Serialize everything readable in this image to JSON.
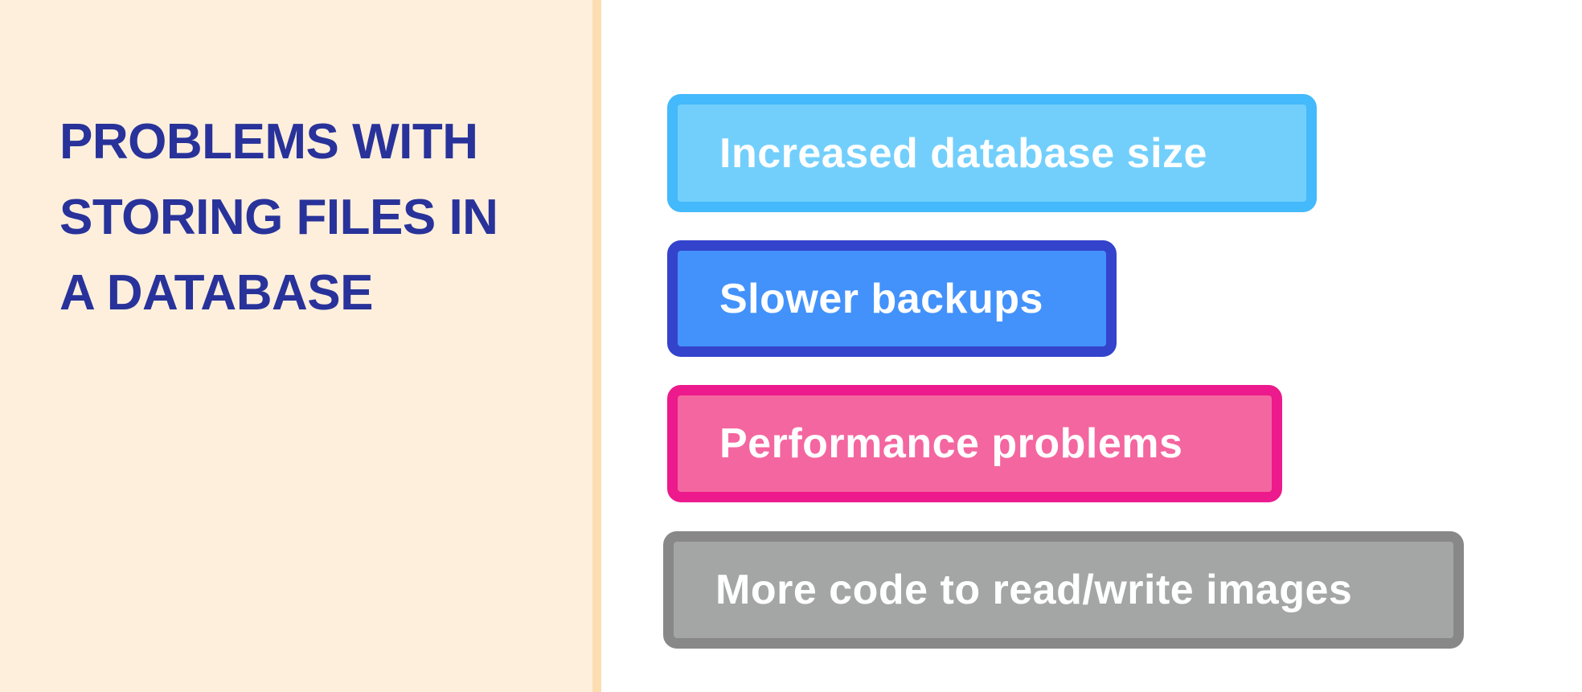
{
  "title": {
    "lines": [
      "PROBLEMS WITH",
      "STORING FILES IN",
      "A DATABASE"
    ],
    "color": "#28329a"
  },
  "panel": {
    "background": "#fdefdc",
    "stripe": "#fddeb3"
  },
  "problems": [
    {
      "label": "Increased database size",
      "fill": "#72cffc",
      "border": "#44b9fb"
    },
    {
      "label": "Slower backups",
      "fill": "#4392fb",
      "border": "#3443cc"
    },
    {
      "label": "Performance problems",
      "fill": "#f466a0",
      "border": "#ec1a8c"
    },
    {
      "label": "More code to read/write images",
      "fill": "#a4a6a5",
      "border": "#878887"
    }
  ]
}
